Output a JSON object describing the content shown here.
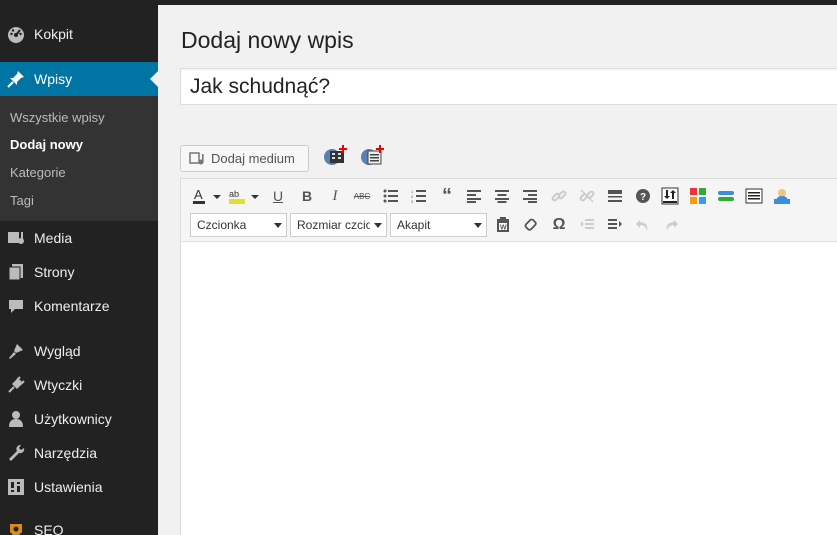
{
  "sidebar": {
    "items": [
      {
        "label": "Kokpit",
        "icon": "dashboard-icon"
      },
      {
        "label": "Wpisy",
        "icon": "pin-icon",
        "active": true
      },
      {
        "label": "Media",
        "icon": "media-icon"
      },
      {
        "label": "Strony",
        "icon": "pages-icon"
      },
      {
        "label": "Komentarze",
        "icon": "comments-icon"
      },
      {
        "label": "Wygląd",
        "icon": "appearance-icon"
      },
      {
        "label": "Wtyczki",
        "icon": "plugins-icon"
      },
      {
        "label": "Użytkownicy",
        "icon": "users-icon"
      },
      {
        "label": "Narzędzia",
        "icon": "tools-icon"
      },
      {
        "label": "Ustawienia",
        "icon": "settings-icon"
      },
      {
        "label": "SEO",
        "icon": "seo-icon"
      }
    ],
    "submenu": [
      {
        "label": "Wszystkie wpisy"
      },
      {
        "label": "Dodaj nowy",
        "current": true
      },
      {
        "label": "Kategorie"
      },
      {
        "label": "Tagi"
      }
    ]
  },
  "main": {
    "page_title": "Dodaj nowy wpis",
    "post_title_value": "Jak schudnąć?",
    "add_media_label": "Dodaj medium"
  },
  "editor": {
    "font_select": "Czcionka",
    "size_select": "Rozmiar czcionki",
    "format_select": "Akapit"
  },
  "colors": {
    "sidebar_bg": "#222222",
    "active_bg": "#0074a2",
    "submenu_bg": "#333333"
  }
}
